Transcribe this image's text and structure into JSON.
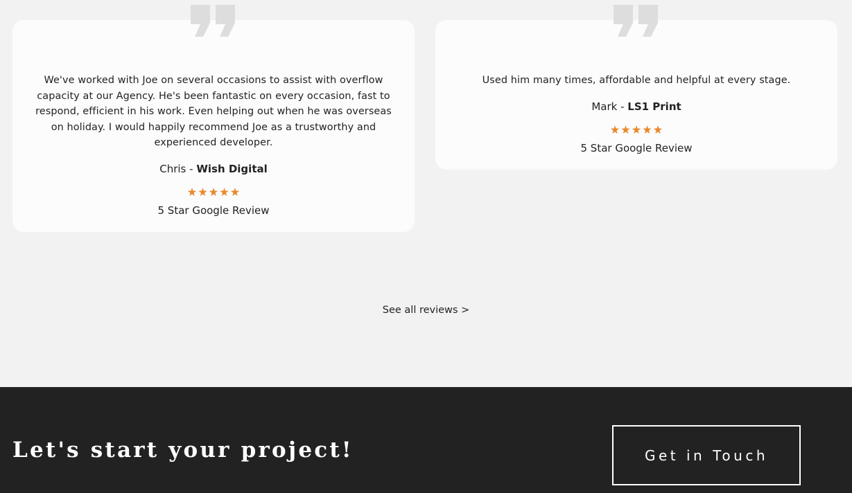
{
  "reviews": [
    {
      "text": "We've worked with Joe on several occasions to assist with overflow capacity at our Agency. He's been fantastic on every occasion, fast to respond, efficient in his work. Even helping out when he was overseas on holiday. I would happily recommend Joe as a trustworthy and experienced developer.",
      "reviewer": "Chris",
      "separator": " - ",
      "company": "Wish Digital",
      "stars": 5,
      "rating_label": "5 Star Google Review"
    },
    {
      "text": "Used him many times, affordable and helpful at every stage.",
      "reviewer": "Mark",
      "separator": " - ",
      "company": "LS1 Print",
      "stars": 5,
      "rating_label": "5 Star Google Review"
    }
  ],
  "see_all_link": "See all reviews >",
  "cta": {
    "title": "Let's start your project!",
    "button_label": "Get in Touch"
  },
  "colors": {
    "background": "#f2f2f2",
    "card": "#fcfcfc",
    "star": "#e8892b",
    "quote_icon": "#dcdcdc",
    "footer": "#222222"
  },
  "icons": {
    "quote": "quote-icon",
    "star": "star-icon"
  }
}
